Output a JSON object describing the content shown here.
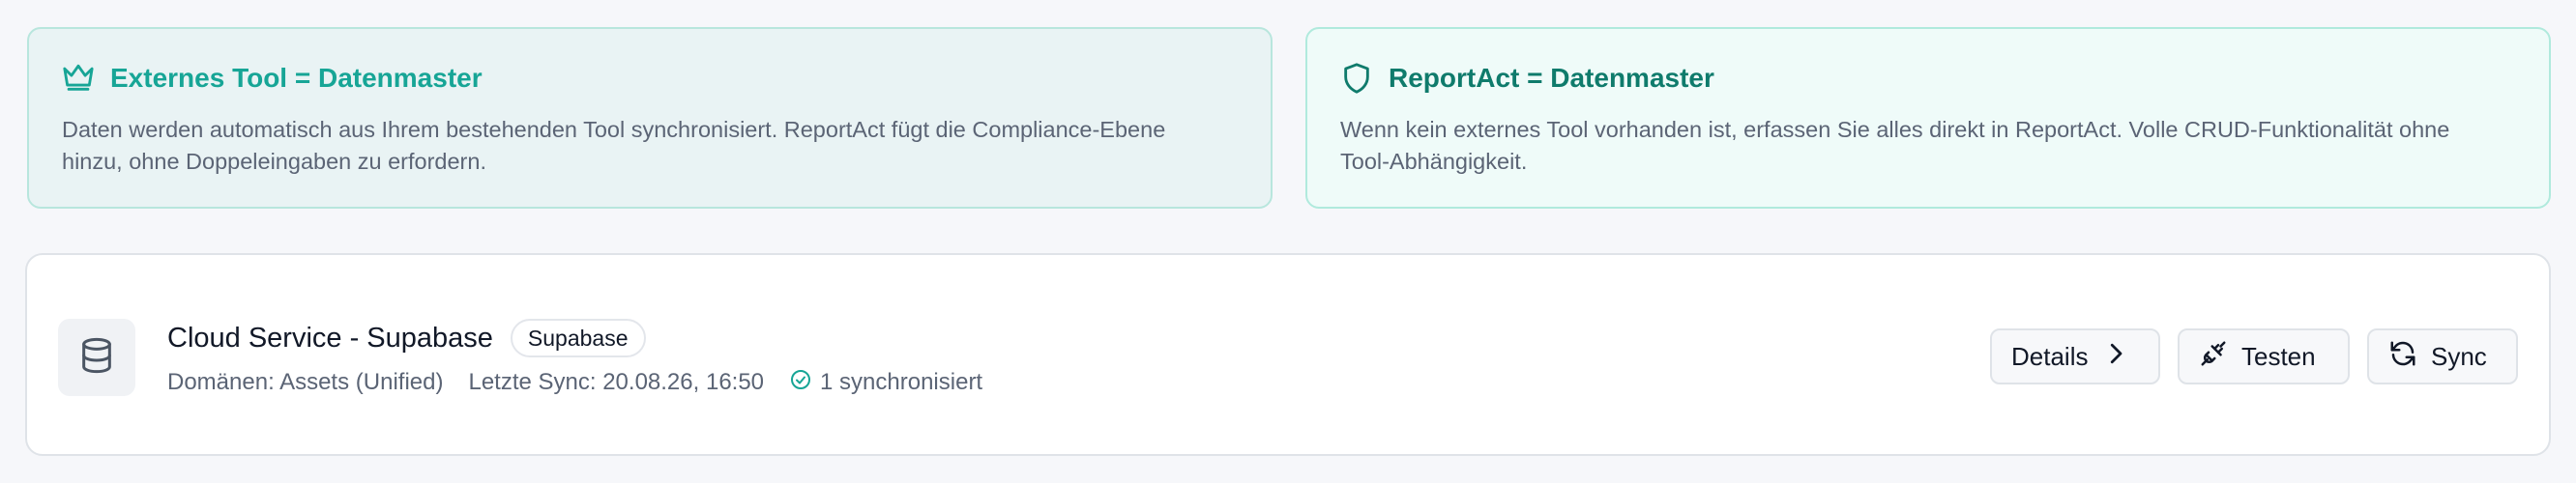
{
  "info_cards": [
    {
      "title": "Externes Tool = Datenmaster",
      "icon": "crown-icon",
      "description": "Daten werden automatisch aus Ihrem bestehenden Tool synchronisiert. ReportAct fügt die Compliance-Ebene hinzu, ohne Doppeleingaben zu erfordern."
    },
    {
      "title": "ReportAct = Datenmaster",
      "icon": "shield-icon",
      "description": "Wenn kein externes Tool vorhanden ist, erfassen Sie alles direkt in ReportAct. Volle CRUD-Funktionalität ohne Tool-Abhängigkeit."
    }
  ],
  "connection": {
    "icon": "database-icon",
    "name": "Cloud Service - Supabase",
    "provider_badge": "Supabase",
    "domains": "Domänen: Assets (Unified)",
    "last_sync": "Letzte Sync: 20.08.26, 16:50",
    "synced_status": "1 synchronisiert",
    "actions": {
      "details_label": "Details",
      "test_label": "Testen",
      "sync_label": "Sync"
    }
  },
  "colors": {
    "accent_teal": "#17a596",
    "accent_dark_teal": "#0f7b6c",
    "muted_text": "#5b6475"
  }
}
